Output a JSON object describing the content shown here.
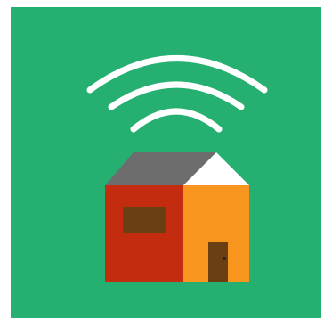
{
  "colors": {
    "page_background": "#ffffff",
    "tile_background": "#25b072",
    "signal_arcs": "#ffffff",
    "roof": "#6d6d6d",
    "roof_gable": "#ffffff",
    "wall_left": "#c32c0e",
    "wall_right": "#f7951e",
    "window": "#6b3f14",
    "door": "#6b3f14",
    "door_knob": "#1a1a1a"
  },
  "icons": {
    "main": "smart-home-wifi-icon",
    "signal": "wifi-signal-icon",
    "house": "house-icon"
  },
  "signal": {
    "arc_count": 3
  }
}
